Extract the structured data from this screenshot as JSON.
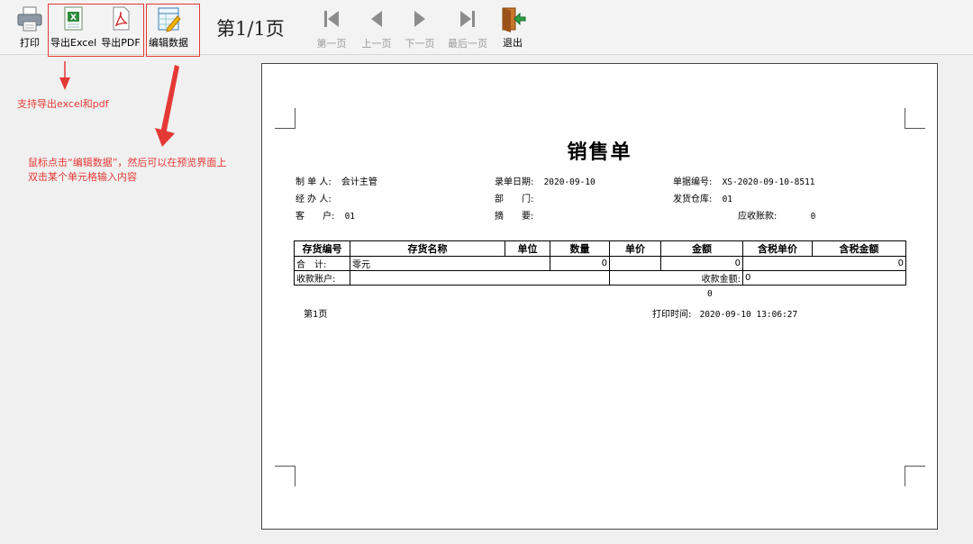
{
  "toolbar": {
    "print_label": "打印",
    "export_excel_label": "导出Excel",
    "export_pdf_label": "导出PDF",
    "edit_data_label": "编辑数据",
    "page_indicator": "第1/1页",
    "first_label": "第一页",
    "prev_label": "上一页",
    "next_label": "下一页",
    "last_label": "最后一页",
    "exit_label": "退出"
  },
  "annotations": {
    "export_note": "支持导出excel和pdf",
    "edit_note_line1": "鼠标点击“编辑数据”，然后可以在预览界面上",
    "edit_note_line2": "双击某个单元格输入内容",
    "color": "#e53935"
  },
  "document": {
    "title": "销售单",
    "maker_label": "制 单 人:",
    "maker_value": "会计主管",
    "entry_date_label": "录单日期:",
    "entry_date_value": "2020-09-10",
    "doc_no_label": "单据编号:",
    "doc_no_value": "XS-2020-09-10-8511",
    "handler_label": "经 办 人:",
    "dept_label": "部　　门:",
    "warehouse_label": "发货仓库:",
    "warehouse_value": "01",
    "customer_label": "客　　户:",
    "customer_value": "01",
    "summary_label": "摘　　要:",
    "receivable_label": "应收账款:",
    "receivable_value": "0",
    "table": {
      "headers": [
        "存货编号",
        "存货名称",
        "单位",
        "数量",
        "单价",
        "金额",
        "含税单价",
        "含税金额"
      ],
      "total_label": "合　计:",
      "total_in_words": "零元",
      "total_qty": "0",
      "total_amount": "0",
      "total_tax_amount": "0",
      "account_label": "收款账户:",
      "received_label": "收款金额:",
      "received_value": "0"
    },
    "below_table_value": "0",
    "page_label": "第1页",
    "print_time_label": "打印时间:",
    "print_time_value": "2020-09-10 13:06:27"
  }
}
